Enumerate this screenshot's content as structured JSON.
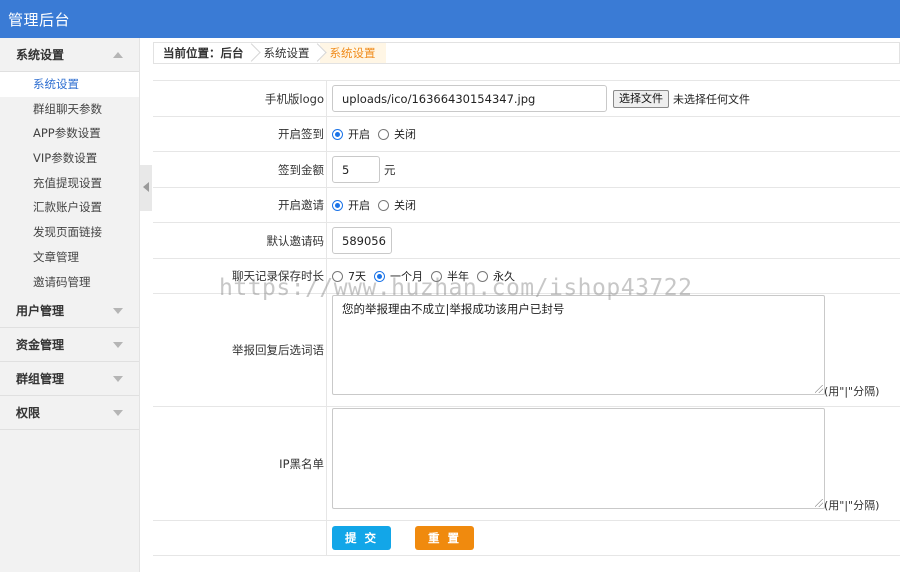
{
  "app": {
    "title": "管理后台"
  },
  "sidebar": {
    "groups": [
      {
        "label": "系统设置",
        "expanded": true,
        "items": [
          "系统设置",
          "群组聊天参数",
          "APP参数设置",
          "VIP参数设置",
          "充值提现设置",
          "汇款账户设置",
          "发现页面链接",
          "文章管理",
          "邀请码管理"
        ],
        "active_item": "系统设置"
      },
      {
        "label": "用户管理",
        "expanded": false
      },
      {
        "label": "资金管理",
        "expanded": false
      },
      {
        "label": "群组管理",
        "expanded": false
      },
      {
        "label": "权限",
        "expanded": false
      }
    ]
  },
  "breadcrumb": [
    "当前位置：后台",
    "系统设置",
    "系统设置"
  ],
  "form": {
    "mobile_logo": {
      "label": "手机版logo",
      "value": "uploads/ico/16366430154347.jpg",
      "file_button": "选择文件",
      "file_status": "未选择任何文件"
    },
    "checkin_enable": {
      "label": "开启签到",
      "options": [
        "开启",
        "关闭"
      ],
      "selected": "开启"
    },
    "checkin_amount": {
      "label": "签到金额",
      "value": "5",
      "unit": "元"
    },
    "invite_enable": {
      "label": "开启邀请",
      "options": [
        "开启",
        "关闭"
      ],
      "selected": "开启"
    },
    "default_invite_code": {
      "label": "默认邀请码",
      "value": "589056"
    },
    "chat_retention": {
      "label": "聊天记录保存时长",
      "options": [
        "7天",
        "一个月",
        "半年",
        "永久"
      ],
      "selected": "一个月"
    },
    "report_reply": {
      "label": "举报回复后选词语",
      "value": "您的举报理由不成立|举报成功该用户已封号",
      "hint": "(用\"|\"分隔)"
    },
    "ip_blacklist": {
      "label": "IP黑名单",
      "value": "",
      "hint": "(用\"|\"分隔)"
    },
    "submit_label": "提 交",
    "reset_label": "重 置"
  },
  "watermark": "https://www.huzhan.com/ishop43722",
  "colors": {
    "topbar": "#3a7bd5",
    "active_link": "#2f6fd1",
    "breadcrumb_current": "#f08c1c",
    "submit": "#12a6e8",
    "reset": "#f08a0e"
  }
}
